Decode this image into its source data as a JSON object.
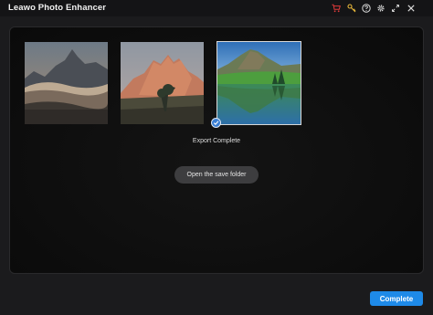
{
  "app": {
    "title": "Leawo Photo Enhancer"
  },
  "titlebar": {
    "icons": [
      "cart-icon",
      "key-icon",
      "help-icon",
      "settings-icon",
      "maximize-icon",
      "close-icon"
    ],
    "cart_color": "#e03a3a",
    "key_color": "#e8b73a"
  },
  "gallery": {
    "photos": [
      {
        "name": "photo-misty-peaks",
        "selected": false
      },
      {
        "name": "photo-sunset-mountain",
        "selected": false
      },
      {
        "name": "photo-lake-reflection",
        "selected": true
      }
    ]
  },
  "status": {
    "export_text": "Export Complete"
  },
  "actions": {
    "open_folder_label": "Open the save folder",
    "complete_label": "Complete"
  },
  "colors": {
    "accent": "#1e8ae8",
    "check": "#3a7fd5"
  }
}
